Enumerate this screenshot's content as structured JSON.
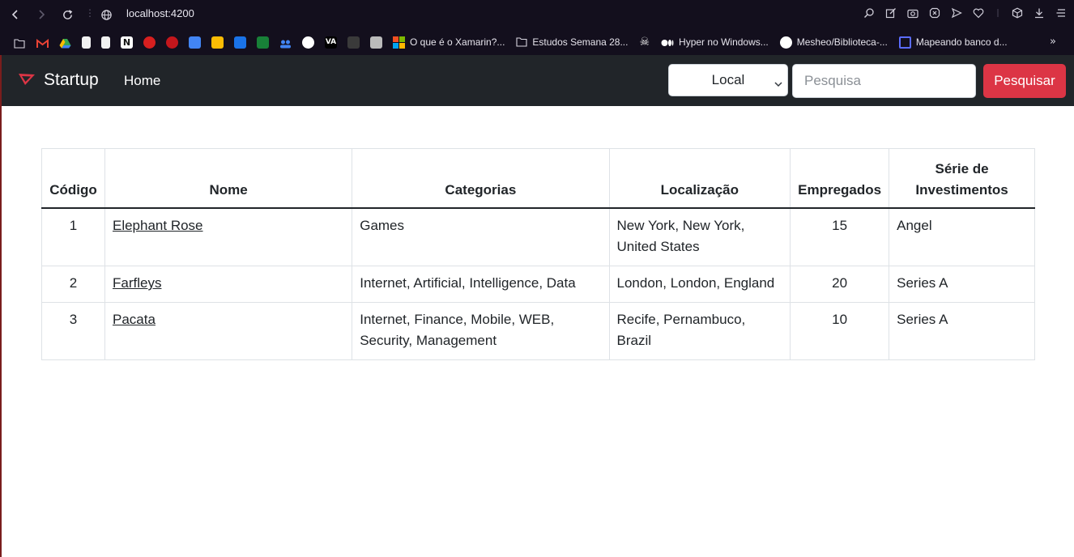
{
  "browser": {
    "url": "localhost:4200",
    "bookmarks": [
      {
        "label": "O que é o Xamarin?...",
        "icon": "microsoft-icon"
      },
      {
        "label": "Estudos Semana 28...",
        "icon": "folder-icon"
      },
      {
        "label": "Hyper no Windows...",
        "icon": "medium-icon"
      },
      {
        "label": "Mesheo/Biblioteca-...",
        "icon": "github-icon"
      },
      {
        "label": "Mapeando banco d...",
        "icon": "page-icon"
      }
    ]
  },
  "navbar": {
    "brand": "Startup",
    "home": "Home",
    "select_value": "Local",
    "search_placeholder": "Pesquisa",
    "search_button": "Pesquisar",
    "accent": "#dc3545"
  },
  "table": {
    "headers": [
      "Código",
      "Nome",
      "Categorias",
      "Localização",
      "Empregados",
      "Série de Investimentos"
    ],
    "rows": [
      {
        "codigo": "1",
        "nome": "Elephant Rose",
        "categorias": "Games",
        "localizacao": "New York, New York, United States",
        "empregados": "15",
        "serie": "Angel"
      },
      {
        "codigo": "2",
        "nome": "Farfleys",
        "categorias": "Internet, Artificial, Intelligence, Data",
        "localizacao": "London, London, England",
        "empregados": "20",
        "serie": "Series A"
      },
      {
        "codigo": "3",
        "nome": "Pacata",
        "categorias": "Internet, Finance, Mobile, WEB, Security, Management",
        "localizacao": "Recife, Pernambuco, Brazil",
        "empregados": "10",
        "serie": "Series A"
      }
    ]
  }
}
